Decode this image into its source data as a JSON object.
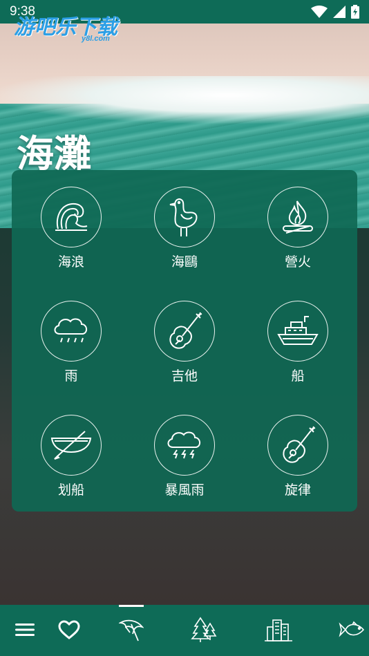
{
  "status_bar": {
    "time": "9:38"
  },
  "watermark": {
    "text": "游吧乐下载",
    "sub": "y8l.com"
  },
  "page": {
    "title": "海灘"
  },
  "sounds": [
    {
      "label": "海浪",
      "icon": "wave-icon"
    },
    {
      "label": "海鷗",
      "icon": "seagull-icon"
    },
    {
      "label": "營火",
      "icon": "campfire-icon"
    },
    {
      "label": "雨",
      "icon": "rain-cloud-icon"
    },
    {
      "label": "吉他",
      "icon": "guitar-icon"
    },
    {
      "label": "船",
      "icon": "ship-icon"
    },
    {
      "label": "划船",
      "icon": "rowboat-icon"
    },
    {
      "label": "暴風雨",
      "icon": "storm-cloud-icon"
    },
    {
      "label": "旋律",
      "icon": "guitar-icon"
    }
  ],
  "bottom_nav": {
    "items": [
      "menu-icon",
      "heart-icon",
      "beach-umbrella-icon",
      "forest-icon",
      "city-icon",
      "fish-icon"
    ],
    "active": "beach-umbrella-icon"
  },
  "colors": {
    "primary": "#0e6b57",
    "card": "#0f6854",
    "icon_stroke": "#ffffff"
  }
}
